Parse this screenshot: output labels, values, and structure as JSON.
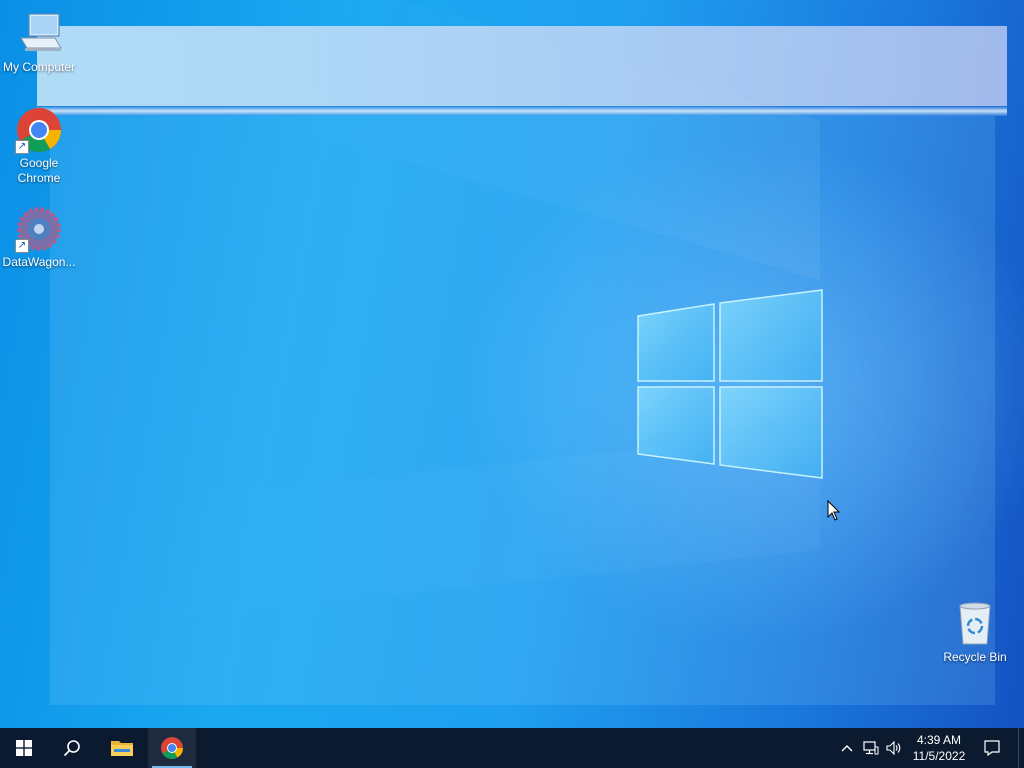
{
  "desktop": {
    "icons": [
      {
        "label": "My Computer",
        "icon": "computer-icon"
      },
      {
        "label": "Google\nChrome",
        "icon": "chrome-icon"
      },
      {
        "label": "DataWagon...",
        "icon": "datawagon-icon"
      },
      {
        "label": "Recycle Bin",
        "icon": "recycle-bin-icon"
      }
    ]
  },
  "taskbar": {
    "start_icon": "windows-start-icon",
    "search_icon": "search-icon",
    "pinned": [
      {
        "name": "file-explorer",
        "icon": "folder-icon",
        "active": false
      },
      {
        "name": "google-chrome",
        "icon": "chrome-icon",
        "active": true
      }
    ],
    "tray": {
      "chevron_icon": "chevron-up-icon",
      "network_icon": "network-icon",
      "volume_icon": "speaker-icon",
      "notification_icon": "notification-icon"
    },
    "clock": {
      "time": "4:39 AM",
      "date": "11/5/2022"
    }
  },
  "colors": {
    "taskbar_bg": "#0b1a2e",
    "accent": "#76b9ed",
    "desktop_blue": "#1aa8f0"
  }
}
